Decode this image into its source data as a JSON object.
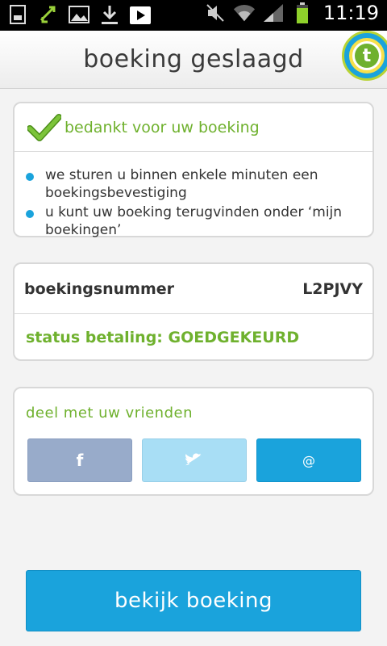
{
  "status_bar": {
    "time": "11:19",
    "left_icons": [
      "sd-card-icon",
      "sync-icon",
      "image-icon",
      "download-icon",
      "play-store-icon"
    ],
    "right_icons": [
      "mute-icon",
      "wifi-icon",
      "signal-icon",
      "battery-icon"
    ]
  },
  "header": {
    "title": "boeking geslaagd",
    "logo_letter": "t"
  },
  "confirmation": {
    "thanks": "bedankt voor uw boeking",
    "bullets": [
      "we sturen u binnen enkele minuten een boekingsbevestiging",
      "u kunt uw boeking terugvinden onder ‘mijn boekingen’"
    ]
  },
  "booking": {
    "number_label": "boekingsnummer",
    "number_value": "L2PJVY",
    "status": "status betaling: GOEDGEKEURD"
  },
  "share": {
    "label": "deel met uw vrienden",
    "facebook": "f",
    "email": "@"
  },
  "cta": {
    "label": "bekijk boeking"
  },
  "colors": {
    "accent_blue": "#1aa3dc",
    "accent_green": "#6fb12e",
    "facebook": "#98abca",
    "twitter": "#a8def5"
  }
}
